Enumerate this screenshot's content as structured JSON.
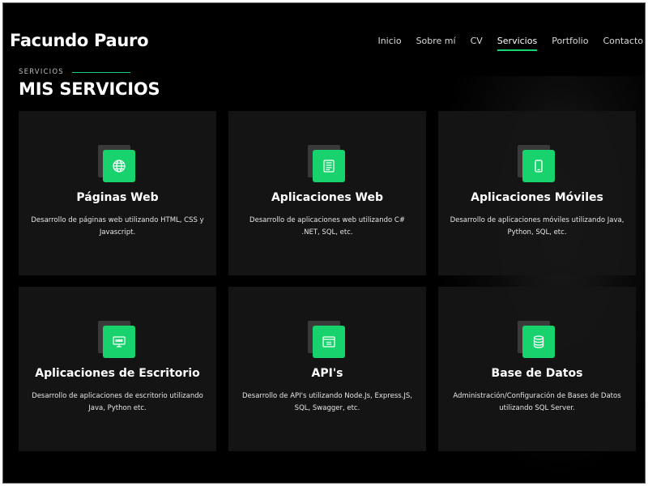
{
  "header": {
    "brand": "Facundo Pauro",
    "nav": [
      "Inicio",
      "Sobre mí",
      "CV",
      "Servicios",
      "Portfolio",
      "Contacto"
    ],
    "active_nav": "Servicios",
    "accent_color": "#18d26e"
  },
  "section": {
    "label": "SERVICIOS",
    "title": "MIS SERVICIOS"
  },
  "services": [
    {
      "icon": "globe-icon",
      "title": "Páginas Web",
      "description": "Desarrollo de páginas web utilizando HTML, CSS y Javascript."
    },
    {
      "icon": "code-window-icon",
      "title": "Aplicaciones Web",
      "description": "Desarrollo de aplicaciones web utilizando C# .NET, SQL, etc."
    },
    {
      "icon": "mobile-phone-icon",
      "title": "Aplicaciones Móviles",
      "description": "Desarrollo de aplicaciones móviles utilizando Java, Python, SQL, etc."
    },
    {
      "icon": "desktop-monitor-icon",
      "title": "Aplicaciones de Escritorio",
      "description": "Desarrollo de aplicaciones de escritorio utilizando Java, Python etc."
    },
    {
      "icon": "api-window-icon",
      "title": "API's",
      "description": "Desarrollo de API's utilizando Node.Js, Express.JS, SQL, Swagger, etc."
    },
    {
      "icon": "database-icon",
      "title": "Base de Datos",
      "description": "Administración/Configuración de Bases de Datos utilizando SQL Server."
    }
  ]
}
